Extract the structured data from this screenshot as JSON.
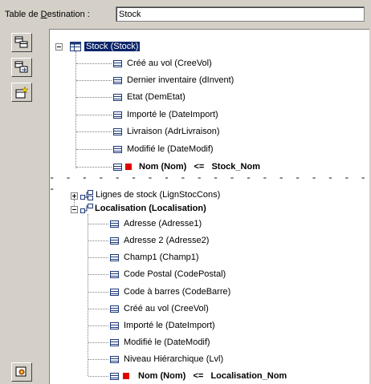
{
  "header": {
    "label_prefix": "Table de ",
    "label_accel": "D",
    "label_suffix": "estination :",
    "value": "Stock"
  },
  "toolbar": {
    "buttons": [
      "tables-icon",
      "copy-table-icon",
      "new-item-icon",
      "settings-icon"
    ]
  },
  "tree": {
    "root": "Stock (Stock)",
    "root_items": [
      "Créé au vol (CreeVol)",
      "Dernier inventaire (dInvent)",
      "Etat (DemEtat)",
      "Importé le (DateImport)",
      "Livraison (AdrLivraison)",
      "Modifié le (DateModif)"
    ],
    "root_key": "Nom (Nom)   <=   Stock_Nom",
    "separator": "- - - - - - - - - - - - - - - - - - - - -",
    "link1": "Lignes de stock (LignStocCons)",
    "link2": "Localisation (Localisation)",
    "link2_items": [
      "Adresse (Adresse1)",
      "Adresse 2 (Adresse2)",
      "Champ1 (Champ1)",
      "Code Postal (CodePostal)",
      "Code à barres (CodeBarre)",
      "Créé au vol (CreeVol)",
      "Importé le (DateImport)",
      "Modifié le (DateModif)",
      "Niveau Hiérarchique (Lvl)"
    ],
    "link2_key": "Nom (Nom)   <=   Localisation_Nom"
  },
  "colors": {
    "selection": "#0a246a",
    "key_marker": "#e00000",
    "background": "#d4d0c8"
  }
}
